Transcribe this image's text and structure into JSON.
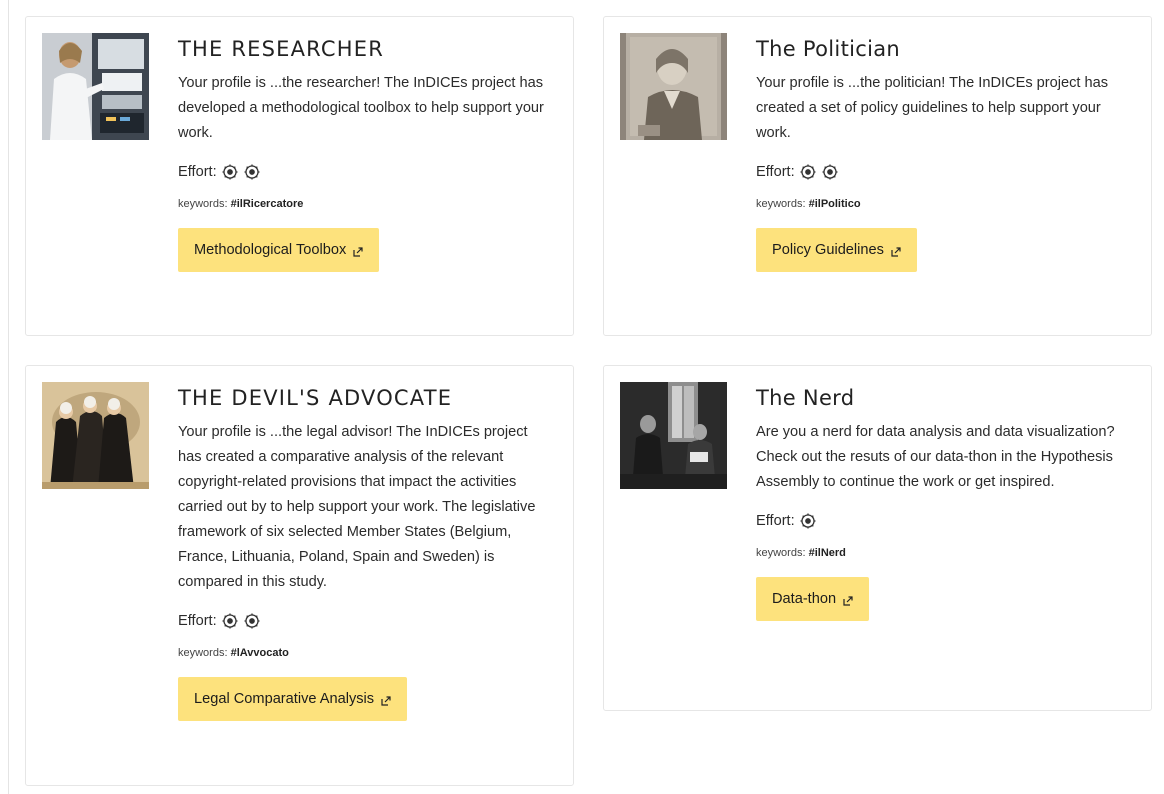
{
  "cards": [
    {
      "title": "THE RESEARCHER",
      "description": "Your profile is ...the researcher! The InDICEs project has developed a methodological toolbox to help support your work.",
      "effort_label": "Effort:",
      "effort_level": 2,
      "keywords_label": "keywords:",
      "keyword": "#ilRicercatore",
      "button_label": "Methodological Toolbox",
      "image": "researcher-photo"
    },
    {
      "title": "The Politician",
      "description": "Your profile is ...the politician! The InDICEs project has created a set of policy guidelines to help support your work.",
      "effort_label": "Effort:",
      "effort_level": 2,
      "keywords_label": "keywords:",
      "keyword": "#ilPolitico",
      "button_label": "Policy Guidelines",
      "image": "politician-engraving"
    },
    {
      "title": "THE DEVIL'S ADVOCATE",
      "description": "Your profile is ...the legal advisor! The InDICEs project has created a comparative analysis of the relevant copyright-related provisions that impact the activities carried out by to help support your work. The legislative framework of six selected Member States (Belgium, France, Lithuania, Poland, Spain and Sweden) is compared in this study.",
      "effort_label": "Effort:",
      "effort_level": 2,
      "keywords_label": "keywords:",
      "keyword": "#lAvvocato",
      "button_label": "Legal Comparative Analysis",
      "image": "lawyers-caricature"
    },
    {
      "title": "The Nerd",
      "description": "Are you a nerd for data analysis and data visualization? Check out the resuts of our data-thon in the Hypothesis Assembly to continue the work or get inspired.",
      "effort_label": "Effort:",
      "effort_level": 1,
      "keywords_label": "keywords:",
      "keyword": "#ilNerd",
      "button_label": "Data-thon",
      "image": "nerd-photo"
    }
  ],
  "colors": {
    "button_bg": "#fde27d",
    "card_border": "#e6e6e6"
  },
  "icons": {
    "effort": "gear-icon",
    "button": "external-link-icon"
  }
}
